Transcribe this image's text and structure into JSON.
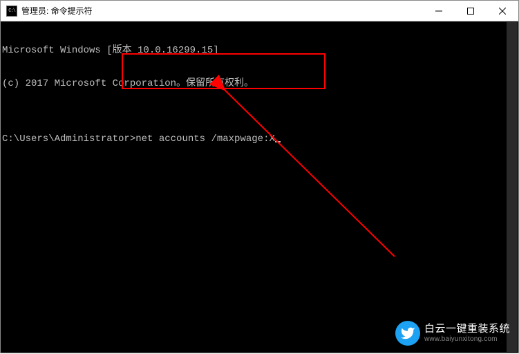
{
  "window": {
    "title": "管理员: 命令提示符",
    "icon_text": "C:\\"
  },
  "terminal": {
    "line1": "Microsoft Windows [版本 10.0.16299.15]",
    "line2": "(c) 2017 Microsoft Corporation。保留所有权利。",
    "prompt": "C:\\Users\\Administrator>",
    "command": "net accounts /maxpwage:X"
  },
  "annotation": {
    "highlight_color": "#ff0000",
    "arrow_color": "#ff0000"
  },
  "watermark": {
    "text_top": "白云一键重装系统",
    "text_bottom": "www.baiyunxitong.com"
  }
}
